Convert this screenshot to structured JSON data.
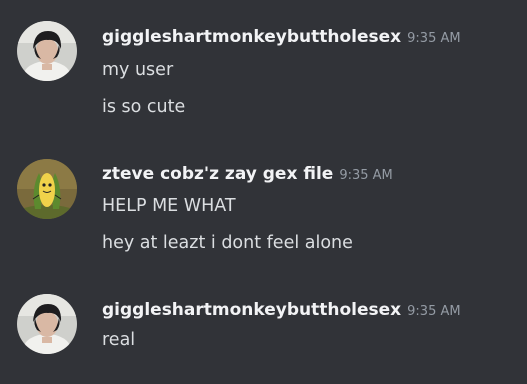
{
  "messages": [
    {
      "username": "giggleshartmonkeybuttholesex",
      "timestamp": "9:35 AM",
      "avatar": "photo-avatar-icon",
      "lines": [
        "my user",
        "is so cute"
      ]
    },
    {
      "username": "zteve cobz'z zay gex file",
      "timestamp": "9:35 AM",
      "avatar": "corn-cartoon-avatar-icon",
      "lines": [
        "HELP ME WHAT",
        "hey at leazt i dont feel alone"
      ]
    },
    {
      "username": "giggleshartmonkeybuttholesex",
      "timestamp": "9:35 AM",
      "avatar": "photo-avatar-icon",
      "lines": [
        "real"
      ]
    }
  ],
  "colors": {
    "background": "#313338",
    "username": "#f2f3f5",
    "timestamp": "#949ba4",
    "message_text": "#dbdee1"
  }
}
